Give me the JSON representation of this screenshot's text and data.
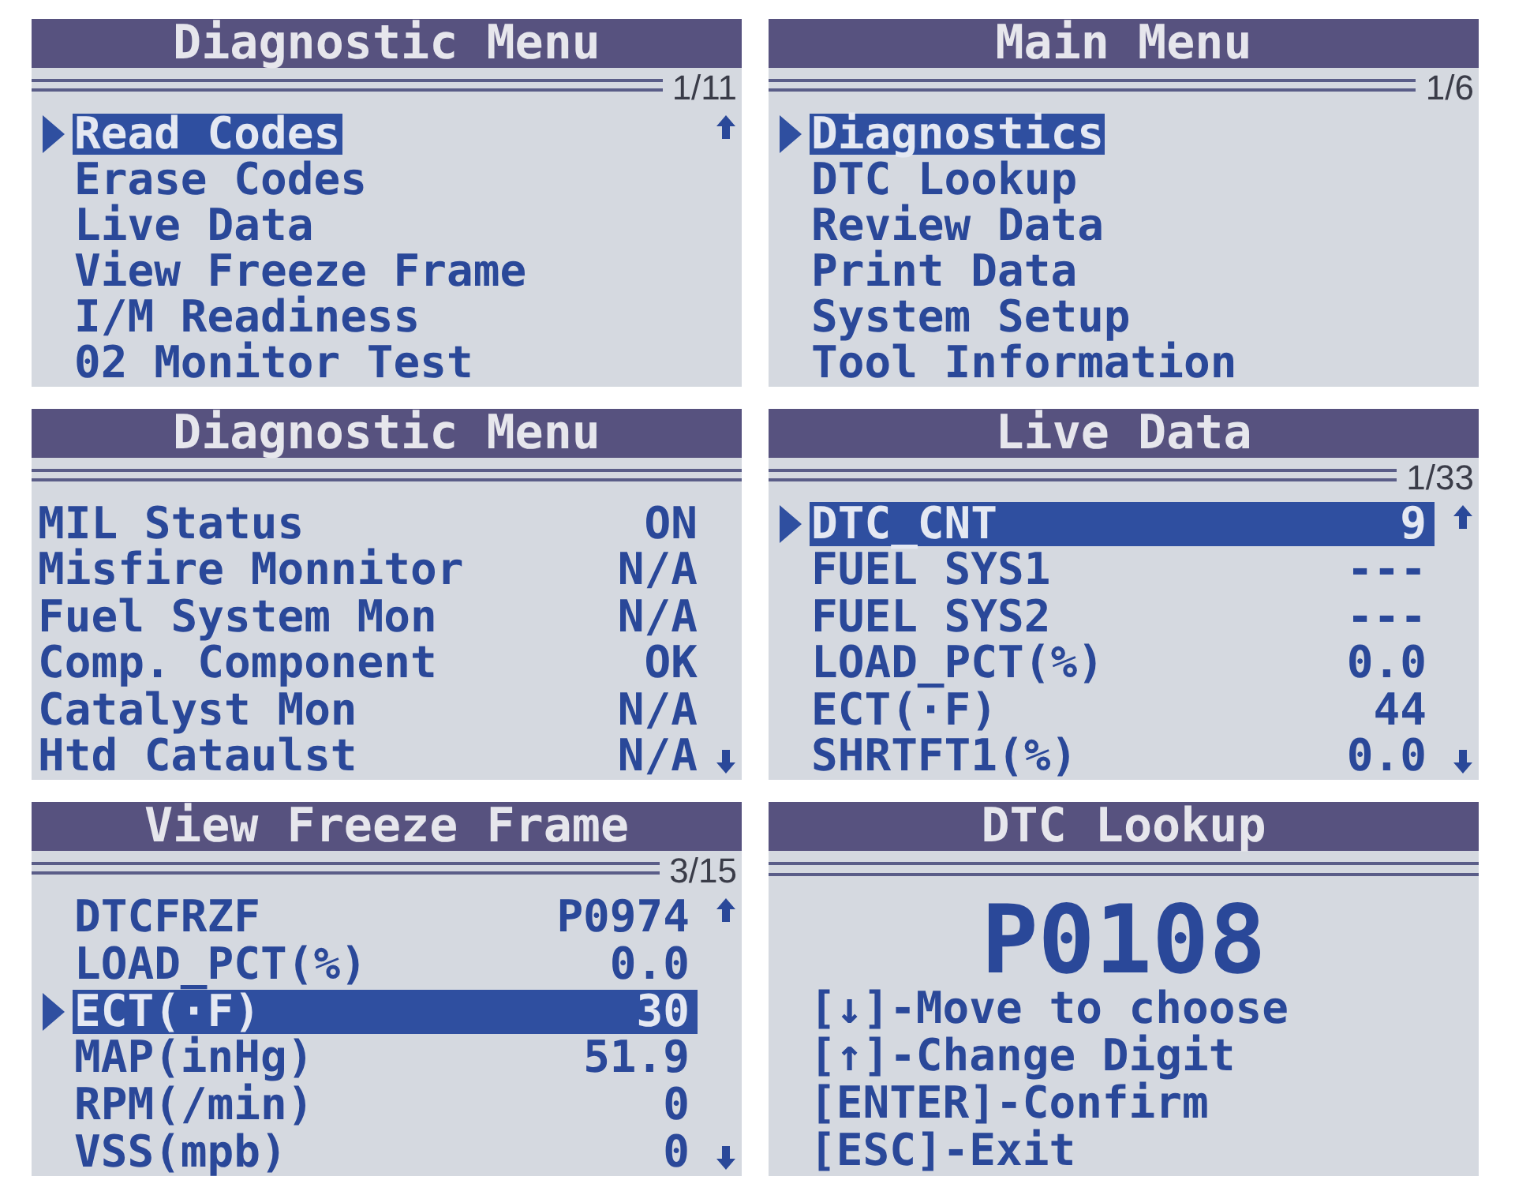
{
  "screens": [
    {
      "kind": "menu",
      "title": "Diagnostic Menu",
      "page": "1/11",
      "more_above": true,
      "more_below": false,
      "items": [
        {
          "label": "Read Codes",
          "selected": true
        },
        {
          "label": "Erase Codes",
          "selected": false
        },
        {
          "label": "Live Data",
          "selected": false
        },
        {
          "label": "View Freeze Frame",
          "selected": false
        },
        {
          "label": "I/M Readiness",
          "selected": false
        },
        {
          "label": "02 Monitor Test",
          "selected": false
        }
      ]
    },
    {
      "kind": "menu",
      "title": "Main Menu",
      "page": "1/6",
      "more_above": false,
      "more_below": false,
      "items": [
        {
          "label": "Diagnostics",
          "selected": true
        },
        {
          "label": "DTC Lookup",
          "selected": false
        },
        {
          "label": "Review Data",
          "selected": false
        },
        {
          "label": "Print Data",
          "selected": false
        },
        {
          "label": "System Setup",
          "selected": false
        },
        {
          "label": "Tool Information",
          "selected": false
        }
      ]
    },
    {
      "kind": "status",
      "title": "Diagnostic Menu",
      "more_above": false,
      "more_below": true,
      "items": [
        {
          "label": "MIL Status",
          "value": "ON"
        },
        {
          "label": "Misfire Monnitor",
          "value": "N/A"
        },
        {
          "label": "Fuel System Mon",
          "value": "N/A"
        },
        {
          "label": "Comp. Component",
          "value": "OK"
        },
        {
          "label": "Catalyst Mon",
          "value": "N/A"
        },
        {
          "label": "Htd Cataulst",
          "value": "N/A"
        }
      ]
    },
    {
      "kind": "data",
      "title": "Live Data",
      "page": "1/33",
      "more_above": true,
      "more_below": true,
      "items": [
        {
          "label": "DTC_CNT",
          "value": "9",
          "selected": true
        },
        {
          "label": "FUEL SYS1",
          "value": "---",
          "selected": false
        },
        {
          "label": "FUEL SYS2",
          "value": "---",
          "selected": false
        },
        {
          "label": "LOAD_PCT(%)",
          "value": "0.0",
          "selected": false
        },
        {
          "label": "ECT(·F)",
          "value": "44",
          "selected": false
        },
        {
          "label": "SHRTFT1(%)",
          "value": "0.0",
          "selected": false
        }
      ]
    },
    {
      "kind": "data",
      "title": "View Freeze Frame",
      "page": "3/15",
      "more_above": true,
      "more_below": true,
      "items": [
        {
          "label": "DTCFRZF",
          "value": "P0974",
          "selected": false
        },
        {
          "label": "LOAD_PCT(%)",
          "value": "0.0",
          "selected": false
        },
        {
          "label": "ECT(·F)",
          "value": "30",
          "selected": true
        },
        {
          "label": "MAP(inHg)",
          "value": "51.9",
          "selected": false
        },
        {
          "label": "RPM(/min)",
          "value": "0",
          "selected": false
        },
        {
          "label": "VSS(mpb)",
          "value": "0",
          "selected": false
        }
      ]
    },
    {
      "kind": "lookup",
      "title": "DTC Lookup",
      "code": "P0108",
      "instructions": [
        "[↓]-Move to choose",
        "[↑]-Change Digit",
        "[ENTER]-Confirm",
        "[ESC]-Exit"
      ]
    }
  ]
}
